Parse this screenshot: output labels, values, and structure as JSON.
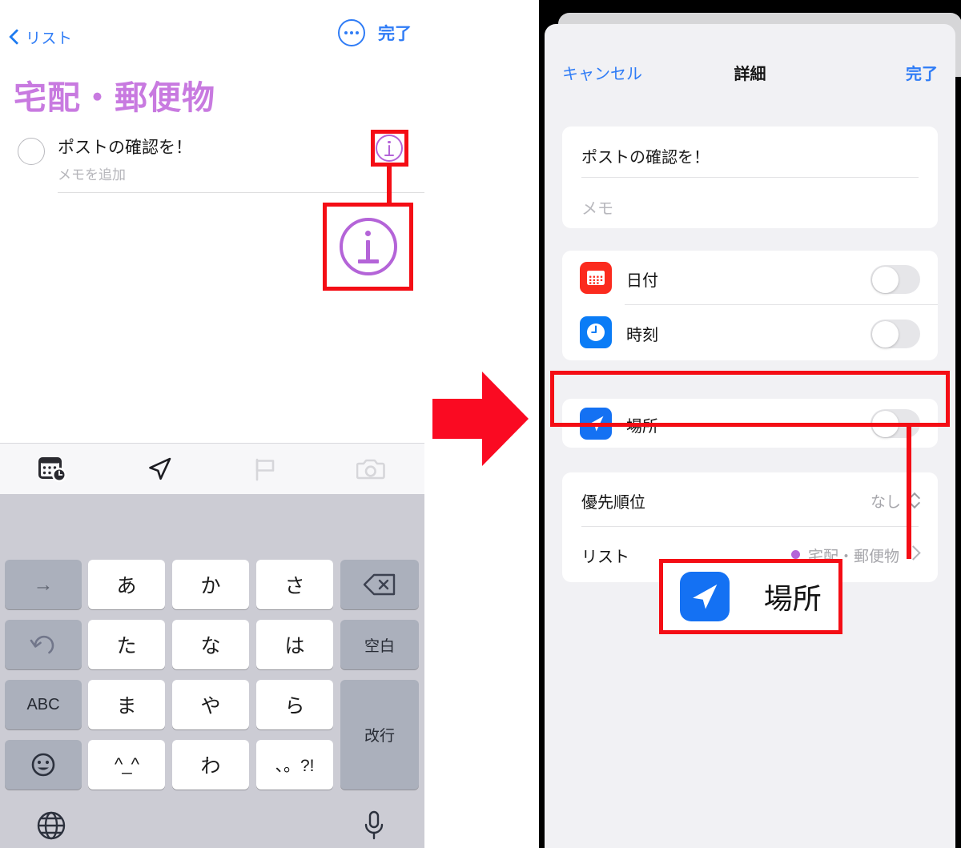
{
  "left_phone": {
    "nav": {
      "back_label": "リスト",
      "back_icon": "chevron-left-icon",
      "more_icon": "ellipsis-circle-icon",
      "done_label": "完了"
    },
    "list_title": "宅配・郵便物",
    "list_title_color": "#c87ae0",
    "task": {
      "checkbox_icon": "empty-circle-icon",
      "title": "ポストの確認を！",
      "memo_placeholder": "メモを追加",
      "info_icon": "info-circle-icon",
      "info_icon_color": "#b464d8"
    },
    "toolbar_items": [
      {
        "icon": "calendar-clock-icon",
        "enabled": true
      },
      {
        "icon": "location-arrow-icon",
        "enabled": true
      },
      {
        "icon": "flag-icon",
        "enabled": false
      },
      {
        "icon": "camera-icon",
        "enabled": false
      }
    ],
    "keyboard": {
      "rows": [
        [
          {
            "label": "→",
            "style": "gray"
          },
          {
            "label": "あ",
            "style": "white"
          },
          {
            "label": "か",
            "style": "white"
          },
          {
            "label": "さ",
            "style": "white"
          },
          {
            "label": "⌫",
            "style": "gray",
            "icon": "backspace-icon"
          }
        ],
        [
          {
            "label": "↺",
            "style": "gray",
            "icon": "undo-icon"
          },
          {
            "label": "た",
            "style": "white"
          },
          {
            "label": "な",
            "style": "white"
          },
          {
            "label": "は",
            "style": "white"
          },
          {
            "label": "空白",
            "style": "gray"
          }
        ],
        [
          {
            "label": "ABC",
            "style": "gray"
          },
          {
            "label": "ま",
            "style": "white"
          },
          {
            "label": "や",
            "style": "white"
          },
          {
            "label": "ら",
            "style": "white"
          },
          {
            "label": "改行",
            "style": "gray"
          }
        ],
        [
          {
            "label": "☺",
            "style": "gray",
            "icon": "emoji-icon"
          },
          {
            "label": "^_^",
            "style": "white"
          },
          {
            "label": "わ",
            "style": "white"
          },
          {
            "label": "、。?!",
            "style": "white"
          }
        ]
      ],
      "bottom": {
        "globe_icon": "globe-icon",
        "mic_icon": "microphone-icon"
      }
    }
  },
  "annotations": {
    "accent_color": "#f40d15",
    "info_callout_icon": "info-circle-icon",
    "location_callout": {
      "icon": "location-arrow-icon",
      "label": "場所"
    },
    "arrow_icon": "right-arrow-icon"
  },
  "right_phone": {
    "nav": {
      "cancel_label": "キャンセル",
      "title": "詳細",
      "done_label": "完了"
    },
    "title_group": {
      "task_title": "ポストの確認を！",
      "memo_placeholder": "メモ"
    },
    "datetime_group": [
      {
        "icon": "calendar-icon",
        "icon_color": "#fb2b1e",
        "label": "日付",
        "toggle_on": false
      },
      {
        "icon": "clock-icon",
        "icon_color": "#0a7cf6",
        "label": "時刻",
        "toggle_on": false
      }
    ],
    "location_group": [
      {
        "icon": "location-arrow-icon",
        "icon_color": "#1471f3",
        "label": "場所",
        "toggle_on": false
      }
    ],
    "meta_group": [
      {
        "label": "優先順位",
        "value": "なし",
        "control": "stepper-icon"
      },
      {
        "label": "リスト",
        "value": "宅配・郵便物",
        "dot_color": "#b464d8",
        "control": "chevron-right-icon"
      }
    ]
  }
}
